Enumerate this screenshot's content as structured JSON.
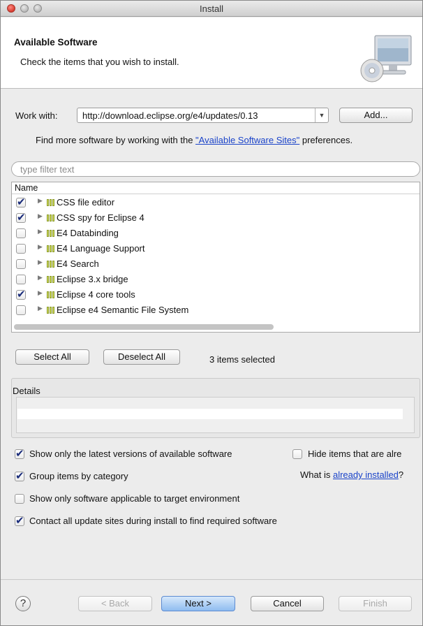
{
  "window": {
    "title": "Install"
  },
  "header": {
    "title": "Available Software",
    "description": "Check the items that you wish to install."
  },
  "work_with": {
    "label": "Work with:",
    "value": "http://download.eclipse.org/e4/updates/0.13",
    "add_label": "Add...",
    "hint_prefix": "Find more software by working with the ",
    "hint_link": "\"Available Software Sites\"",
    "hint_suffix": " preferences."
  },
  "filter": {
    "placeholder": "type filter text"
  },
  "tree": {
    "column_header": "Name",
    "items": [
      {
        "label": "CSS file editor",
        "checked": true
      },
      {
        "label": "CSS spy for Eclipse 4",
        "checked": true
      },
      {
        "label": "E4 Databinding",
        "checked": false
      },
      {
        "label": "E4 Language Support",
        "checked": false
      },
      {
        "label": "E4 Search",
        "checked": false
      },
      {
        "label": "Eclipse 3.x  bridge",
        "checked": false
      },
      {
        "label": "Eclipse 4 core tools",
        "checked": true
      },
      {
        "label": "Eclipse e4 Semantic File System",
        "checked": false
      }
    ]
  },
  "selection": {
    "select_all": "Select All",
    "deselect_all": "Deselect All",
    "status": "3 items selected"
  },
  "details": {
    "title": "Details"
  },
  "options": {
    "latest_versions": {
      "label": "Show only the latest versions of available software",
      "checked": true
    },
    "hide_installed": {
      "label": "Hide items that are alre",
      "checked": false
    },
    "group_by_category": {
      "label": "Group items by category",
      "checked": true
    },
    "what_is_prefix": "What is ",
    "what_is_link": "already installed",
    "what_is_suffix": "?",
    "target_env": {
      "label": "Show only software applicable to target environment",
      "checked": false
    },
    "contact_sites": {
      "label": "Contact all update sites during install to find required software",
      "checked": true
    }
  },
  "footer": {
    "help": "?",
    "back": "< Back",
    "next": "Next >",
    "cancel": "Cancel",
    "finish": "Finish"
  },
  "colors": {
    "link": "#1a43c9",
    "default_button": "#8fbcf0",
    "package_icon": "#d7e05a"
  },
  "icons": [
    "close-icon",
    "minimize-icon",
    "maximize-icon",
    "install-computer-icon",
    "dropdown-arrow-icon",
    "expander-icon",
    "package-icon",
    "help-icon"
  ]
}
